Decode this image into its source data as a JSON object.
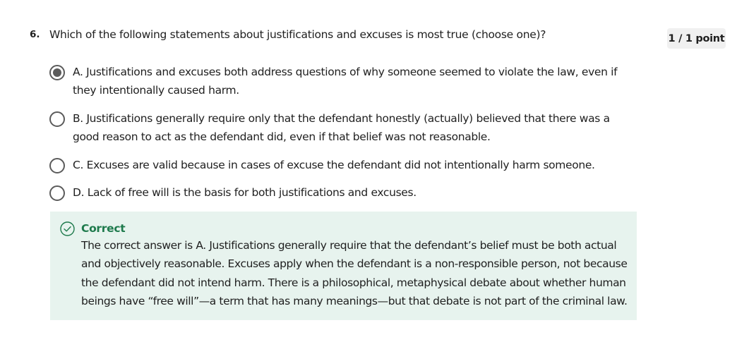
{
  "question": {
    "number": "6.",
    "text": "Which of the following statements about justifications and excuses is most true (choose one)?",
    "points": "1 / 1 point"
  },
  "options": [
    {
      "label": "A. Justifications and excuses both address questions of why someone seemed to violate the law, even if they intentionally caused harm.",
      "selected": true
    },
    {
      "label": "B. Justifications generally require only that the defendant honestly (actually) believed that there was a good reason to act as the defendant did, even if that belief was not reasonable.",
      "selected": false
    },
    {
      "label": "C. Excuses are valid because in cases of excuse the defendant did not intentionally harm someone.",
      "selected": false
    },
    {
      "label": "D. Lack of free will is the basis for both justifications and excuses.",
      "selected": false
    }
  ],
  "feedback": {
    "status": "Correct",
    "icon": "check-circle-icon",
    "body": "The correct answer is A. Justifications generally require that the defendant’s belief must be both actual and objectively reasonable. Excuses apply when the defendant is a non-responsible person, not because the defendant did not intend harm. There is a philosophical, metaphysical debate about whether human beings have “free will”—a term that has many meanings—but that debate is not part of the criminal law.",
    "color": "#1e7a4c",
    "background": "#e7f3ee"
  }
}
